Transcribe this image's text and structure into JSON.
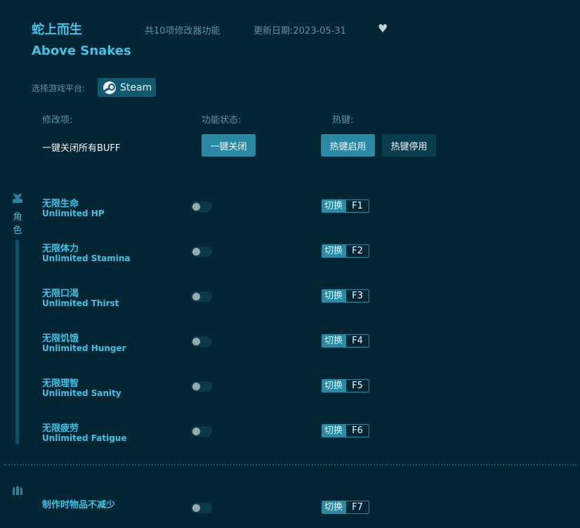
{
  "app": {
    "title_cn": "蛇上而生",
    "title_en": "Above Snakes",
    "feature_count": "共10项修改器功能",
    "update_date": "更新日期:2023-05-31",
    "favorite_icon": "heart-icon"
  },
  "platform": {
    "label": "选择游戏平台:",
    "selected": "Steam",
    "icon": "steam-icon"
  },
  "headers": {
    "modifier": "修改项:",
    "status": "功能状态:",
    "hotkey": "热键:"
  },
  "global": {
    "buff_label": "一键关闭所有BUFF",
    "close_all_button": "一键关闭",
    "hotkey_enable_button": "热键启用",
    "hotkey_disable_button": "热键停用"
  },
  "sections": [
    {
      "label": "角色",
      "icon": "character-icon",
      "items": [
        {
          "cn": "无限生命",
          "en": "Unlimited HP",
          "enabled": false,
          "action": "切换",
          "key": "F1"
        },
        {
          "cn": "无限体力",
          "en": "Unlimited Stamina",
          "enabled": false,
          "action": "切换",
          "key": "F2"
        },
        {
          "cn": "无限口渴",
          "en": "Unlimited Thirst",
          "enabled": false,
          "action": "切换",
          "key": "F3"
        },
        {
          "cn": "无限饥饿",
          "en": "Unlimited Hunger",
          "enabled": false,
          "action": "切换",
          "key": "F4"
        },
        {
          "cn": "无限理智",
          "en": "Unlimited Sanity",
          "enabled": false,
          "action": "切换",
          "key": "F5"
        },
        {
          "cn": "无限疲劳",
          "en": "Unlimited Fatigue",
          "enabled": false,
          "action": "切换",
          "key": "F6"
        }
      ]
    },
    {
      "icon": "crafting-icon",
      "items": [
        {
          "cn": "制作时物品不减少",
          "enabled": false,
          "action": "切换",
          "key": "F7"
        }
      ]
    }
  ],
  "colors": {
    "background": "#022634",
    "accent": "#3fc3e6",
    "button": "#2a8aa4",
    "button_dark": "#083d4e",
    "muted_text": "#5d93a6"
  }
}
